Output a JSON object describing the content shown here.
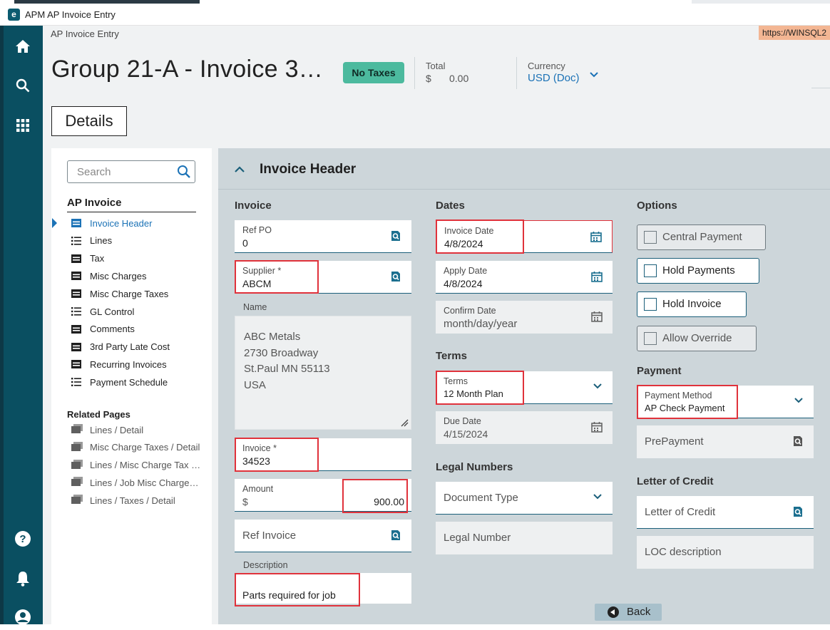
{
  "window": {
    "title": "APM AP Invoice Entry",
    "url": "https://WINSQL2"
  },
  "breadcrumb": "AP Invoice Entry",
  "header": {
    "title": "Group 21-A - Invoice 3…",
    "tax_badge": "No Taxes",
    "total_label": "Total",
    "total_symbol": "$",
    "total_value": "0.00",
    "currency_label": "Currency",
    "currency_value": "USD (Doc)"
  },
  "tab": "Details",
  "nav": {
    "search_placeholder": "Search",
    "heading": "AP Invoice",
    "items": [
      {
        "label": "Invoice Header",
        "icon": "form-icon",
        "active": true
      },
      {
        "label": "Lines",
        "icon": "list-icon"
      },
      {
        "label": "Tax",
        "icon": "form-icon"
      },
      {
        "label": "Misc Charges",
        "icon": "form-icon"
      },
      {
        "label": "Misc Charge Taxes",
        "icon": "form-icon"
      },
      {
        "label": "GL Control",
        "icon": "list-icon"
      },
      {
        "label": "Comments",
        "icon": "form-icon"
      },
      {
        "label": "3rd Party Late Cost",
        "icon": "form-icon"
      },
      {
        "label": "Recurring Invoices",
        "icon": "form-icon"
      },
      {
        "label": "Payment Schedule",
        "icon": "list-icon"
      }
    ],
    "related_heading": "Related Pages",
    "related": [
      {
        "label": "Lines / Detail"
      },
      {
        "label": "Misc Charge Taxes / Detail"
      },
      {
        "label": "Lines / Misc Charge Tax …"
      },
      {
        "label": "Lines / Job Misc Charge…"
      },
      {
        "label": "Lines / Taxes / Detail"
      }
    ]
  },
  "panel": {
    "title": "Invoice Header",
    "invoice": {
      "heading": "Invoice",
      "ref_po_label": "Ref PO",
      "ref_po_value": "0",
      "supplier_label": "Supplier *",
      "supplier_value": "ABCM",
      "name_label": "Name",
      "name_lines": [
        "ABC Metals",
        "2730 Broadway",
        "St.Paul MN 55113",
        "USA"
      ],
      "invoice_label": "Invoice *",
      "invoice_value": "34523",
      "amount_label": "Amount",
      "amount_symbol": "$",
      "amount_value": "900.00",
      "ref_invoice_placeholder": "Ref Invoice",
      "description_label": "Description",
      "description_value": "Parts required for job"
    },
    "dates": {
      "heading": "Dates",
      "invoice_date_label": "Invoice Date",
      "invoice_date_value": "4/8/2024",
      "apply_date_label": "Apply Date",
      "apply_date_value": "4/8/2024",
      "confirm_date_label": "Confirm Date",
      "confirm_date_placeholder": "month/day/year",
      "terms_heading": "Terms",
      "terms_label": "Terms",
      "terms_value": "12 Month Plan",
      "due_date_label": "Due Date",
      "due_date_value": "4/15/2024",
      "legal_heading": "Legal Numbers",
      "document_type_placeholder": "Document Type",
      "legal_number_placeholder": "Legal Number"
    },
    "options": {
      "heading": "Options",
      "central_payment": "Central Payment",
      "hold_payments": "Hold Payments",
      "hold_invoice": "Hold Invoice",
      "allow_override": "Allow Override",
      "payment_heading": "Payment",
      "payment_method_label": "Payment Method",
      "payment_method_value": "AP Check Payment",
      "prepayment_placeholder": "PrePayment",
      "loc_heading": "Letter of Credit",
      "loc_placeholder": "Letter of Credit",
      "loc_desc_placeholder": "LOC description"
    },
    "back_label": "Back"
  },
  "colors": {
    "rail": "#0a4f61",
    "accent": "#1b72b6",
    "badge": "#4cba9e",
    "highlight": "#e0323b",
    "url_badge": "#f3b693"
  }
}
